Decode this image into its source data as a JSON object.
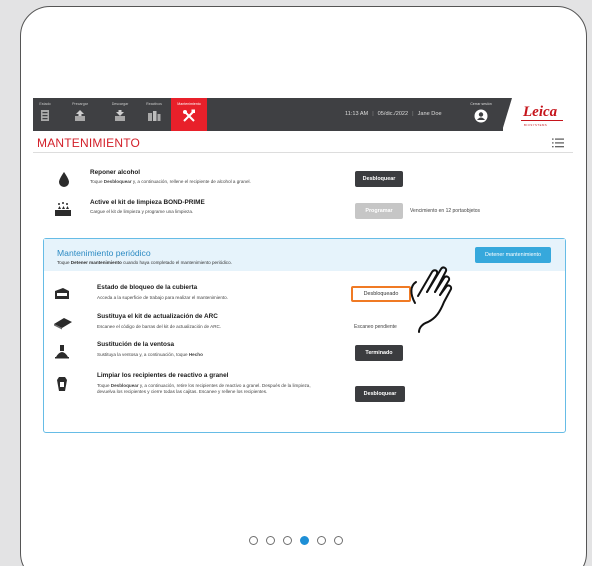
{
  "nav": {
    "tabs": [
      {
        "label": "Estado",
        "icon": "status-icon"
      },
      {
        "label": "Precargar",
        "icon": "preload-icon"
      },
      {
        "label": "Descargar",
        "icon": "unload-icon"
      },
      {
        "label": "Reactivos",
        "icon": "reagents-icon"
      },
      {
        "label": "Mantenimiento",
        "icon": "maintenance-tools-icon"
      }
    ],
    "time": "11:13 AM",
    "date": "05/dic./2022",
    "user": "Jane Doe",
    "logout_label": "Cerrar sesión",
    "logo_text": "Leica",
    "logo_sub": "BIOSYSTEMS"
  },
  "page": {
    "title": "MANTENIMIENTO"
  },
  "tasks": [
    {
      "icon": "alcohol-drop-icon",
      "title": "Reponer alcohol",
      "desc_pre": "Toque ",
      "desc_bold": "Desbloquear",
      "desc_post": " y, a continuación, rellene el recipiente de alcohol a granel.",
      "button": "Desbloquear"
    },
    {
      "icon": "cleaning-kit-icon",
      "title": "Active el kit de limpieza BOND-PRIME",
      "desc": "Cargue el kit de limpieza y programe una limpieza.",
      "button": "Programar",
      "status": "Vencimiento en 12 portaobjetos"
    }
  ],
  "periodic": {
    "title": "Mantenimiento periódico",
    "desc_pre": "Toque ",
    "desc_bold": "Detener mantenimiento",
    "desc_post": " cuando haya completado el mantenimiento periódico.",
    "stop_button": "Detener mantenimiento",
    "items": [
      {
        "icon": "cover-lock-icon",
        "title": "Estado de bloqueo de la cubierta",
        "desc": "Acceda a la superficie de trabajo para realizar el mantenimiento.",
        "button": "Desbloqueado"
      },
      {
        "icon": "arc-kit-icon",
        "title": "Sustituya el kit de actualización de ARC",
        "desc": "Escanee el código de barras del kit de actualización de ARC.",
        "status": "Escaneo pendiente"
      },
      {
        "icon": "suction-cup-icon",
        "title": "Sustitución de la ventosa",
        "desc_pre": "Sustituya la ventosa y, a continuación, toque ",
        "desc_bold": "Hecho",
        "button": "Terminado"
      },
      {
        "icon": "reagent-container-icon",
        "title": "Limpiar los recipientes de reactivo a granel",
        "desc_pre": "Toque ",
        "desc_bold": "Desbloquear",
        "desc_post": " y, a continuación, retire los recipientes de reactivo a granel. Después de la limpieza, devuelva los recipientes y cierre todas las cajitas. Escanee y rellene los recipientes.",
        "button": "Desbloquear"
      }
    ]
  },
  "pager": {
    "count": 6,
    "active": 4
  },
  "colors": {
    "accent_red": "#d3202a",
    "nav_bg": "#3f4043",
    "blue": "#36a8dc",
    "highlight_orange": "#f07a24"
  }
}
